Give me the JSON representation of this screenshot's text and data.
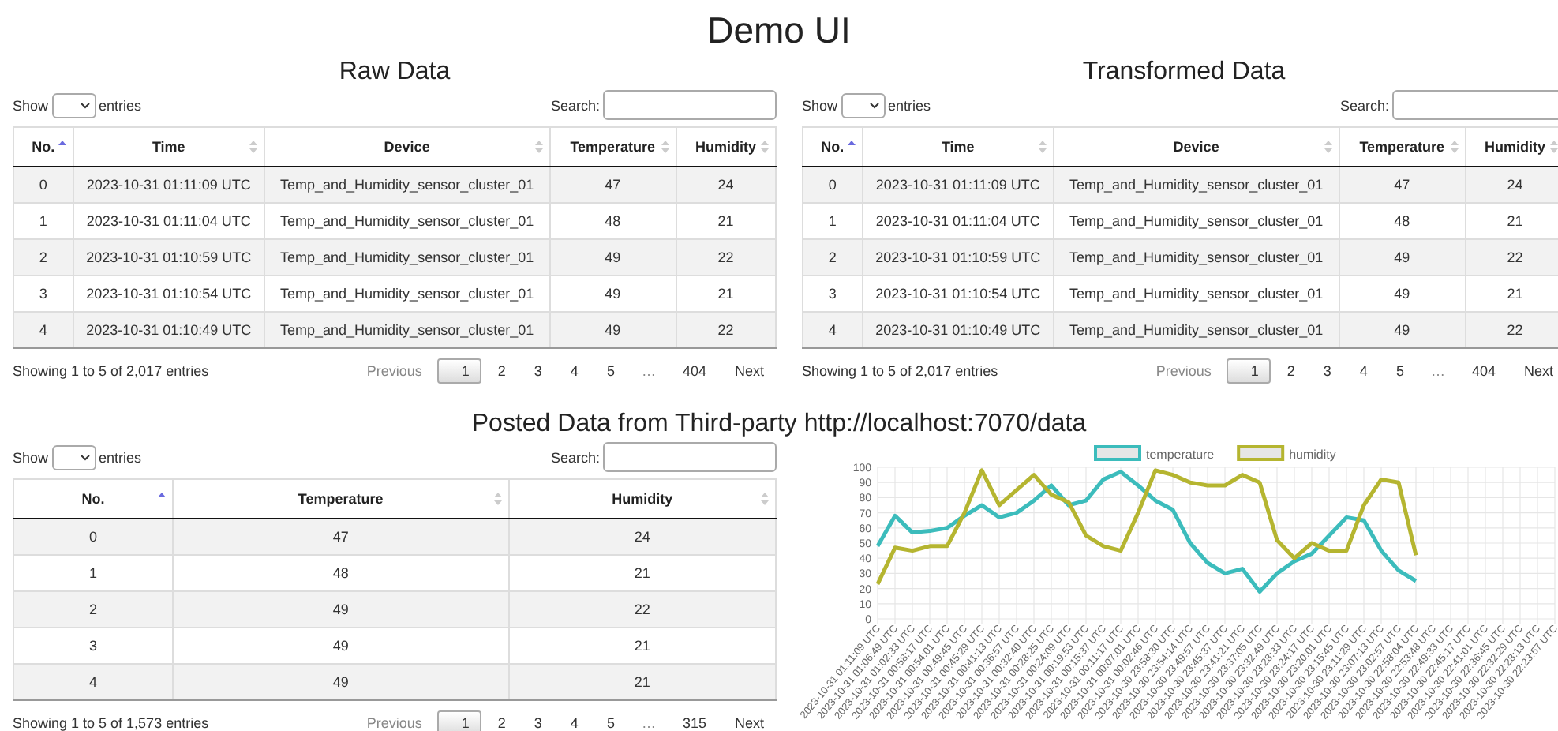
{
  "page_title": "Demo UI",
  "raw": {
    "title": "Raw Data",
    "show_label": "Show",
    "entries_label": "entries",
    "search_label": "Search:",
    "columns": [
      {
        "label": "No.",
        "sorted": true
      },
      {
        "label": "Time",
        "sorted": false
      },
      {
        "label": "Device",
        "sorted": false
      },
      {
        "label": "Temperature",
        "sorted": false
      },
      {
        "label": "Humidity",
        "sorted": false
      }
    ],
    "rows": [
      [
        "0",
        "2023-10-31 01:11:09 UTC",
        "Temp_and_Humidity_sensor_cluster_01",
        "47",
        "24"
      ],
      [
        "1",
        "2023-10-31 01:11:04 UTC",
        "Temp_and_Humidity_sensor_cluster_01",
        "48",
        "21"
      ],
      [
        "2",
        "2023-10-31 01:10:59 UTC",
        "Temp_and_Humidity_sensor_cluster_01",
        "49",
        "22"
      ],
      [
        "3",
        "2023-10-31 01:10:54 UTC",
        "Temp_and_Humidity_sensor_cluster_01",
        "49",
        "21"
      ],
      [
        "4",
        "2023-10-31 01:10:49 UTC",
        "Temp_and_Humidity_sensor_cluster_01",
        "49",
        "22"
      ]
    ],
    "info": "Showing 1 to 5 of 2,017 entries",
    "pagination": [
      {
        "kind": "nav",
        "label": "Previous",
        "disabled": true
      },
      {
        "kind": "page",
        "label": "1",
        "selected": true
      },
      {
        "kind": "page",
        "label": "2",
        "selected": false
      },
      {
        "kind": "page",
        "label": "3",
        "selected": false
      },
      {
        "kind": "page",
        "label": "4",
        "selected": false
      },
      {
        "kind": "page",
        "label": "5",
        "selected": false
      },
      {
        "kind": "ellipsis",
        "label": "…"
      },
      {
        "kind": "page",
        "label": "404",
        "selected": false
      },
      {
        "kind": "nav",
        "label": "Next",
        "disabled": false
      }
    ]
  },
  "transformed": {
    "title": "Transformed Data",
    "show_label": "Show",
    "entries_label": "entries",
    "search_label": "Search:",
    "columns": [
      {
        "label": "No.",
        "sorted": true
      },
      {
        "label": "Time",
        "sorted": false
      },
      {
        "label": "Device",
        "sorted": false
      },
      {
        "label": "Temperature",
        "sorted": false
      },
      {
        "label": "Humidity",
        "sorted": false
      }
    ],
    "rows": [
      [
        "0",
        "2023-10-31 01:11:09 UTC",
        "Temp_and_Humidity_sensor_cluster_01",
        "47",
        "24"
      ],
      [
        "1",
        "2023-10-31 01:11:04 UTC",
        "Temp_and_Humidity_sensor_cluster_01",
        "48",
        "21"
      ],
      [
        "2",
        "2023-10-31 01:10:59 UTC",
        "Temp_and_Humidity_sensor_cluster_01",
        "49",
        "22"
      ],
      [
        "3",
        "2023-10-31 01:10:54 UTC",
        "Temp_and_Humidity_sensor_cluster_01",
        "49",
        "21"
      ],
      [
        "4",
        "2023-10-31 01:10:49 UTC",
        "Temp_and_Humidity_sensor_cluster_01",
        "49",
        "22"
      ]
    ],
    "info": "Showing 1 to 5 of 2,017 entries",
    "pagination": [
      {
        "kind": "nav",
        "label": "Previous",
        "disabled": true
      },
      {
        "kind": "page",
        "label": "1",
        "selected": true
      },
      {
        "kind": "page",
        "label": "2",
        "selected": false
      },
      {
        "kind": "page",
        "label": "3",
        "selected": false
      },
      {
        "kind": "page",
        "label": "4",
        "selected": false
      },
      {
        "kind": "page",
        "label": "5",
        "selected": false
      },
      {
        "kind": "ellipsis",
        "label": "…"
      },
      {
        "kind": "page",
        "label": "404",
        "selected": false
      },
      {
        "kind": "nav",
        "label": "Next",
        "disabled": false
      }
    ]
  },
  "posted_title": "Posted Data from Third-party http://localhost:7070/data",
  "posted": {
    "show_label": "Show",
    "entries_label": "entries",
    "search_label": "Search:",
    "columns": [
      {
        "label": "No.",
        "sorted": true
      },
      {
        "label": "Temperature",
        "sorted": false
      },
      {
        "label": "Humidity",
        "sorted": false
      }
    ],
    "rows": [
      [
        "0",
        "47",
        "24"
      ],
      [
        "1",
        "48",
        "21"
      ],
      [
        "2",
        "49",
        "22"
      ],
      [
        "3",
        "49",
        "21"
      ],
      [
        "4",
        "49",
        "21"
      ]
    ],
    "info": "Showing 1 to 5 of 1,573 entries",
    "pagination": [
      {
        "kind": "nav",
        "label": "Previous",
        "disabled": true
      },
      {
        "kind": "page",
        "label": "1",
        "selected": true
      },
      {
        "kind": "page",
        "label": "2",
        "selected": false
      },
      {
        "kind": "page",
        "label": "3",
        "selected": false
      },
      {
        "kind": "page",
        "label": "4",
        "selected": false
      },
      {
        "kind": "page",
        "label": "5",
        "selected": false
      },
      {
        "kind": "ellipsis",
        "label": "…"
      },
      {
        "kind": "page",
        "label": "315",
        "selected": false
      },
      {
        "kind": "nav",
        "label": "Next",
        "disabled": false
      }
    ]
  },
  "chart_data": {
    "type": "line",
    "grid": true,
    "legend": true,
    "ylim": [
      0,
      100
    ],
    "yticks": [
      0,
      10,
      20,
      30,
      40,
      50,
      60,
      70,
      80,
      90,
      100
    ],
    "categories": [
      "2023-10-31 01:11:09 UTC",
      "2023-10-31 01:06:49 UTC",
      "2023-10-31 01:02:33 UTC",
      "2023-10-31 00:58:17 UTC",
      "2023-10-31 00:54:01 UTC",
      "2023-10-31 00:49:45 UTC",
      "2023-10-31 00:45:29 UTC",
      "2023-10-31 00:41:13 UTC",
      "2023-10-31 00:36:57 UTC",
      "2023-10-31 00:32:40 UTC",
      "2023-10-31 00:28:25 UTC",
      "2023-10-31 00:24:09 UTC",
      "2023-10-31 00:19:53 UTC",
      "2023-10-31 00:15:37 UTC",
      "2023-10-31 00:11:17 UTC",
      "2023-10-31 00:07:01 UTC",
      "2023-10-31 00:02:46 UTC",
      "2023-10-30 23:58:30 UTC",
      "2023-10-30 23:54:14 UTC",
      "2023-10-30 23:49:57 UTC",
      "2023-10-30 23:45:37 UTC",
      "2023-10-30 23:41:21 UTC",
      "2023-10-30 23:37:05 UTC",
      "2023-10-30 23:32:49 UTC",
      "2023-10-30 23:28:33 UTC",
      "2023-10-30 23:24:17 UTC",
      "2023-10-30 23:20:01 UTC",
      "2023-10-30 23:15:45 UTC",
      "2023-10-30 23:11:29 UTC",
      "2023-10-30 23:07:13 UTC",
      "2023-10-30 23:02:57 UTC",
      "2023-10-30 22:58:04 UTC",
      "2023-10-30 22:53:48 UTC",
      "2023-10-30 22:49:33 UTC",
      "2023-10-30 22:45:17 UTC",
      "2023-10-30 22:41:01 UTC",
      "2023-10-30 22:36:45 UTC",
      "2023-10-30 22:32:29 UTC",
      "2023-10-30 22:28:13 UTC",
      "2023-10-30 22:23:57 UTC"
    ],
    "series": [
      {
        "name": "temperature",
        "color": "#3cbcbc",
        "values": [
          48,
          68,
          57,
          58,
          60,
          68,
          75,
          67,
          70,
          78,
          88,
          75,
          78,
          92,
          97,
          88,
          78,
          72,
          50,
          37,
          30,
          33,
          18,
          30,
          38,
          43,
          55,
          67,
          65,
          45,
          32,
          25,
          null,
          null,
          null,
          null,
          null,
          null,
          null,
          null
        ]
      },
      {
        "name": "humidity",
        "color": "#b5b530",
        "values": [
          23,
          47,
          45,
          48,
          48,
          70,
          98,
          75,
          85,
          95,
          82,
          77,
          55,
          48,
          45,
          70,
          98,
          95,
          90,
          88,
          88,
          95,
          90,
          52,
          40,
          50,
          45,
          45,
          75,
          92,
          90,
          42,
          null,
          null,
          null,
          null,
          null,
          null,
          null,
          null
        ]
      }
    ]
  }
}
